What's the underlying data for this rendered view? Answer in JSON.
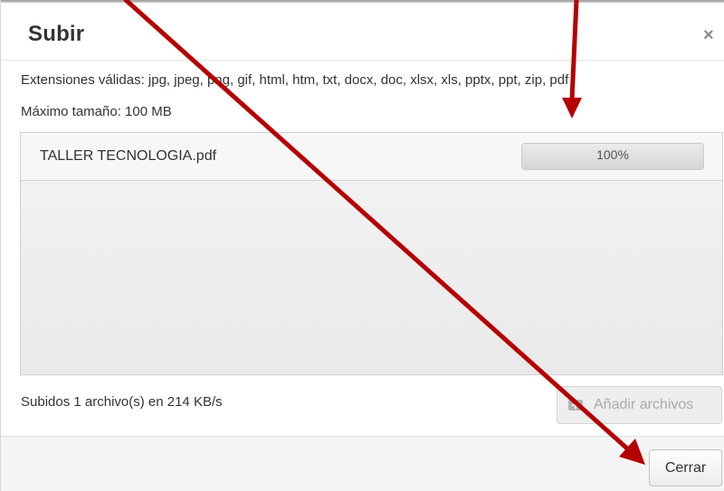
{
  "dialog": {
    "title": "Subir",
    "close_glyph": "×",
    "close_icon": "close-icon"
  },
  "info": {
    "extensions": "Extensiones válidas: jpg, jpeg, png, gif, html, htm, txt, docx, doc, xlsx, xls, pptx, ppt, zip, pdf",
    "max_size": "Máximo tamaño: 100 MB"
  },
  "upload": {
    "files": [
      {
        "name": "TALLER TECNOLOGIA.pdf",
        "progress_label": "100%",
        "progress": 1.0
      }
    ],
    "status": "Subidos 1 archivo(s) en 214 KB/s",
    "add_label": "Añadir archivos",
    "add_icon": "add-file-icon"
  },
  "footer": {
    "close_label": "Cerrar"
  },
  "annotations": {
    "arrow_color": "#b50000"
  }
}
